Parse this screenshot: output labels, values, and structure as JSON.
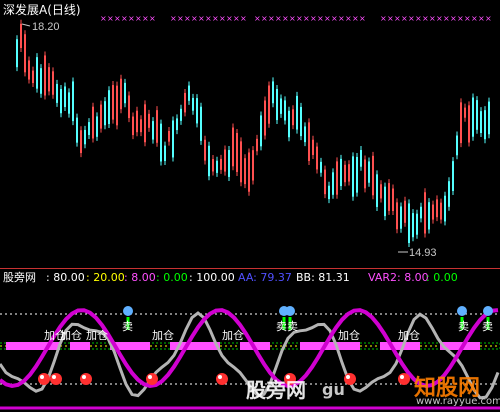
{
  "title": "深发展A(日线)",
  "price_high_label": "18.20",
  "price_low_label": "14.93",
  "indicator": {
    "name": "股旁网",
    "params": [
      ": 80.00",
      ": 20.00",
      ": 8.00",
      ": 0.00",
      ": 100.00"
    ],
    "aa_label": "AA: 79.37",
    "bb_label": "BB: 81.31",
    "var2_label": "VAR2: 8.00",
    "var2_tail": ": 0.00"
  },
  "signal_labels": {
    "jiahe": "加仓",
    "mai": "卖",
    "maimai": "卖卖"
  },
  "watermark": {
    "left": "股旁网",
    "mid": "gu",
    "right": "知股网",
    "url": "www.rayyue.com"
  },
  "colors": {
    "up_candle": "#ff5050",
    "down_candle": "#54ffff",
    "signal_line": "#d000d0",
    "grey_line": "#b4b4b4",
    "magenta_bar": "#ff50ff"
  }
}
